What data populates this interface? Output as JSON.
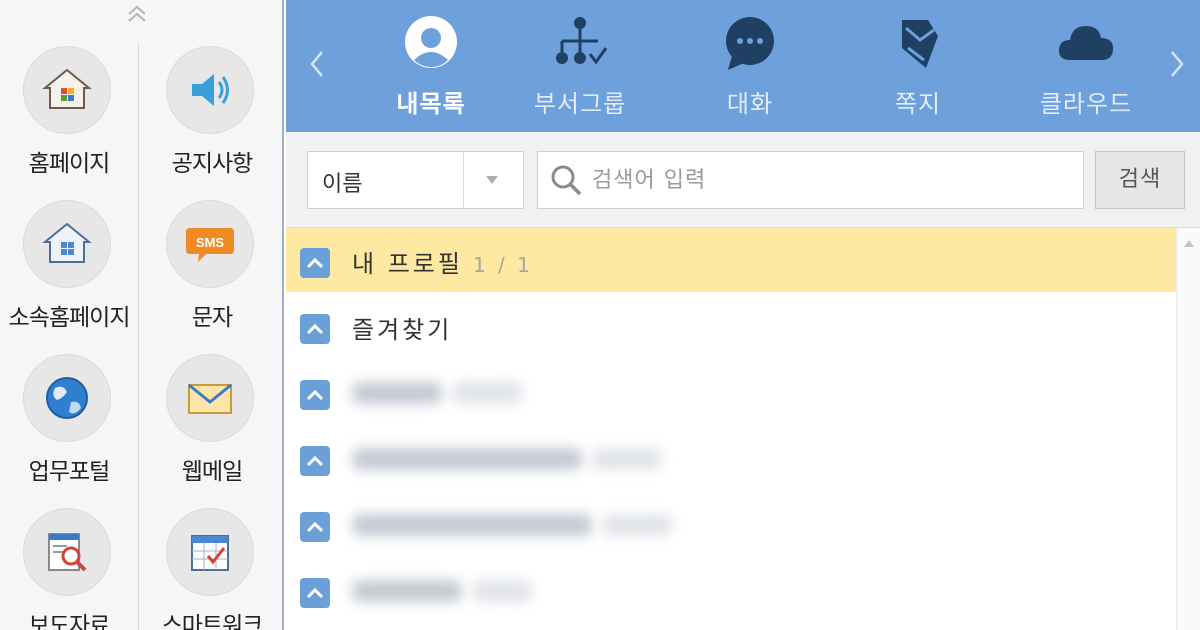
{
  "sidebar": {
    "items": [
      {
        "label": "홈페이지",
        "icon": "home-icon"
      },
      {
        "label": "공지사항",
        "icon": "speaker-icon"
      },
      {
        "label": "소속홈페이지",
        "icon": "department-home-icon"
      },
      {
        "label": "문자",
        "icon": "sms-icon"
      },
      {
        "label": "업무포털",
        "icon": "globe-icon"
      },
      {
        "label": "웹메일",
        "icon": "mail-icon"
      },
      {
        "label": "보도자료",
        "icon": "press-search-icon"
      },
      {
        "label": "스마트워크",
        "icon": "calendar-check-icon"
      }
    ],
    "sms_badge": "SMS"
  },
  "tabs": [
    {
      "label": "내목록",
      "icon": "person-icon",
      "active": true
    },
    {
      "label": "부서그룹",
      "icon": "org-tree-icon",
      "active": false
    },
    {
      "label": "대화",
      "icon": "chat-bubble-icon",
      "active": false
    },
    {
      "label": "쪽지",
      "icon": "note-icon",
      "active": false
    },
    {
      "label": "클라우드",
      "icon": "cloud-icon",
      "active": false
    }
  ],
  "search": {
    "field_selected": "이름",
    "placeholder": "검색어 입력",
    "value": "",
    "button_label": "검색"
  },
  "list": {
    "rows": [
      {
        "label": "내 프로필",
        "count": "1 / 1",
        "highlighted": true
      },
      {
        "label": "즐겨찾기",
        "count": "",
        "highlighted": false
      }
    ]
  },
  "colors": {
    "topbar": "#6ea1dc",
    "highlight_row": "#fde9a1",
    "chevron_badge": "#6b9fd8",
    "sms_orange": "#f08a22"
  }
}
